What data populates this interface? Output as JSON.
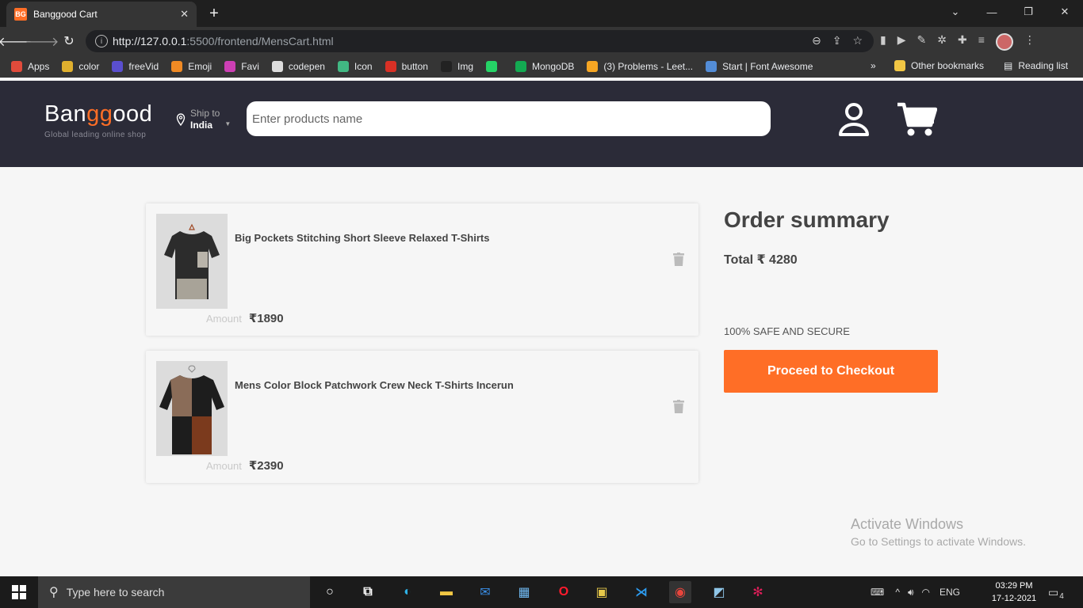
{
  "browser": {
    "tab_title": "Banggood Cart",
    "tab_favicon_text": "BG",
    "url_host": "http://127.0.0.1",
    "url_rest": ":5500/frontend/MensCart.html",
    "bookmarks": [
      {
        "label": "Apps",
        "color": "#e14b3b"
      },
      {
        "label": "color",
        "color": "#e0b02e"
      },
      {
        "label": "freeVid",
        "color": "#5a4fcf"
      },
      {
        "label": "Emoji",
        "color": "#f08a24"
      },
      {
        "label": "Favi",
        "color": "#cc3fb4"
      },
      {
        "label": "codepen",
        "color": "#dddddd"
      },
      {
        "label": "Icon",
        "color": "#41b883"
      },
      {
        "label": "button",
        "color": "#d93025"
      },
      {
        "label": "Img",
        "color": "#222222"
      },
      {
        "label": "",
        "color": "#25d366"
      },
      {
        "label": "MongoDB",
        "color": "#13aa52"
      },
      {
        "label": "(3) Problems - Leet...",
        "color": "#f6a623"
      },
      {
        "label": "Start | Font Awesome",
        "color": "#538dd7"
      }
    ],
    "more_bookmarks": "»",
    "other_bookmarks": "Other bookmarks",
    "reading_list": "Reading list"
  },
  "header": {
    "logo_pre": "Ban",
    "logo_accent": "gg",
    "logo_post": "ood",
    "logo_tagline": "Global leading online shop",
    "ship_label": "Ship to",
    "ship_country": "India",
    "search_placeholder": "Enter products name",
    "accent_color": "#ff6e26",
    "background_color": "#2b2b38"
  },
  "cart": {
    "items": [
      {
        "name": "Big Pockets Stitching Short Sleeve Relaxed T-Shirts",
        "amount_label": "Amount",
        "price": "₹1890"
      },
      {
        "name": "Mens Color Block Patchwork Crew Neck T-Shirts Incerun",
        "amount_label": "Amount",
        "price": "₹2390"
      }
    ]
  },
  "summary": {
    "title": "Order summary",
    "total": "Total ₹ 4280",
    "safe_text": "100% SAFE AND SECURE",
    "checkout_label": "Proceed to Checkout"
  },
  "watermark": {
    "title": "Activate Windows",
    "subtitle": "Go to Settings to activate Windows."
  },
  "taskbar": {
    "search_placeholder": "Type here to search",
    "language": "ENG",
    "time": "03:29 PM",
    "date": "17-12-2021",
    "notification_count": "4"
  }
}
